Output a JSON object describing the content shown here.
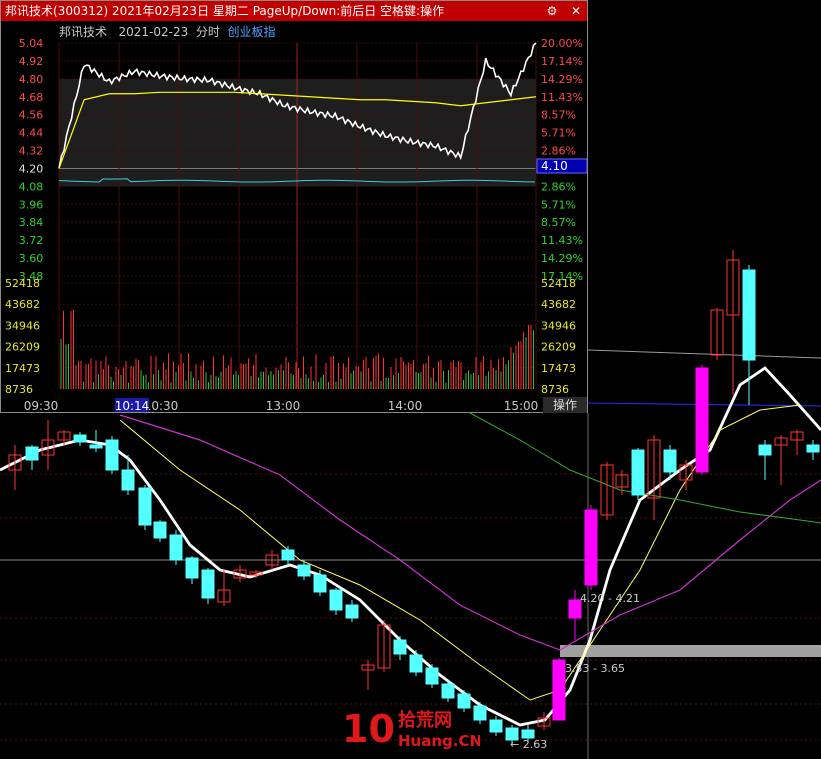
{
  "window": {
    "title": "邦讯技术(300312)  2021年02月23日  星期二  PageUp/Down:前后日  空格键:操作",
    "sub_name": "邦讯技术",
    "sub_date": "2021-02-23",
    "sub_mode": "分时",
    "sub_link": "创业板指",
    "btn_settings": "⚙",
    "btn_close": "✕",
    "tab_operate": "操作",
    "price_ticks": [
      "5.04",
      "4.92",
      "4.80",
      "4.68",
      "4.56",
      "4.44",
      "4.32",
      "4.20",
      "4.08",
      "3.96",
      "3.84",
      "3.72",
      "3.60",
      "3.48"
    ],
    "pct_ticks": [
      "20.00%",
      "17.14%",
      "14.29%",
      "11.43%",
      "8.57%",
      "5.71%",
      "2.86%",
      "0.00%",
      "2.86%",
      "5.71%",
      "8.57%",
      "11.43%",
      "14.29%",
      "17.14%"
    ],
    "vol_ticks": [
      "52418",
      "43682",
      "34946",
      "26209",
      "17473",
      "8736"
    ],
    "time_ticks": [
      "09:30",
      "10:30",
      "13:00",
      "14:00",
      "15:00"
    ],
    "cursor_time": "10:14",
    "cursor_price": "4.10",
    "colors": {
      "title_bg": "#c00000",
      "price_line": "#ffffff",
      "avg_line": "#ffff00",
      "cursor_box": "#0000b0"
    }
  },
  "kline": {
    "annotations": [
      "4.20 - 4.21",
      "3.53 - 3.65",
      "← 2.63"
    ],
    "colors": {
      "up": "#ff3333",
      "down": "#54ffff",
      "limit": "#ff00ff",
      "ma_white": "#ffffff",
      "ma_yellow": "#ffff66",
      "ma_magenta": "#cc33cc",
      "ma_green": "#33aa33"
    }
  },
  "watermark": {
    "brand_num": "10",
    "brand_cn": "拾荒网",
    "brand_en": "Huang.CN"
  },
  "chart_data": {
    "type": "line",
    "title": "邦讯技术(300312) 2021-02-23 分时",
    "x": [
      "09:30",
      "10:30",
      "13:00",
      "14:00",
      "15:00"
    ],
    "price_series": [
      4.2,
      4.9,
      4.78,
      4.85,
      4.82,
      4.8,
      4.79,
      4.74,
      4.7,
      4.62,
      4.58,
      4.55,
      4.48,
      4.42,
      4.38,
      4.35,
      4.28,
      4.92,
      4.7,
      5.04
    ],
    "avg_series": [
      4.2,
      4.66,
      4.7,
      4.7,
      4.71,
      4.71,
      4.71,
      4.71,
      4.7,
      4.69,
      4.68,
      4.67,
      4.66,
      4.66,
      4.65,
      4.64,
      4.62,
      4.64,
      4.66,
      4.68
    ],
    "ylim": [
      3.48,
      5.04
    ]
  }
}
